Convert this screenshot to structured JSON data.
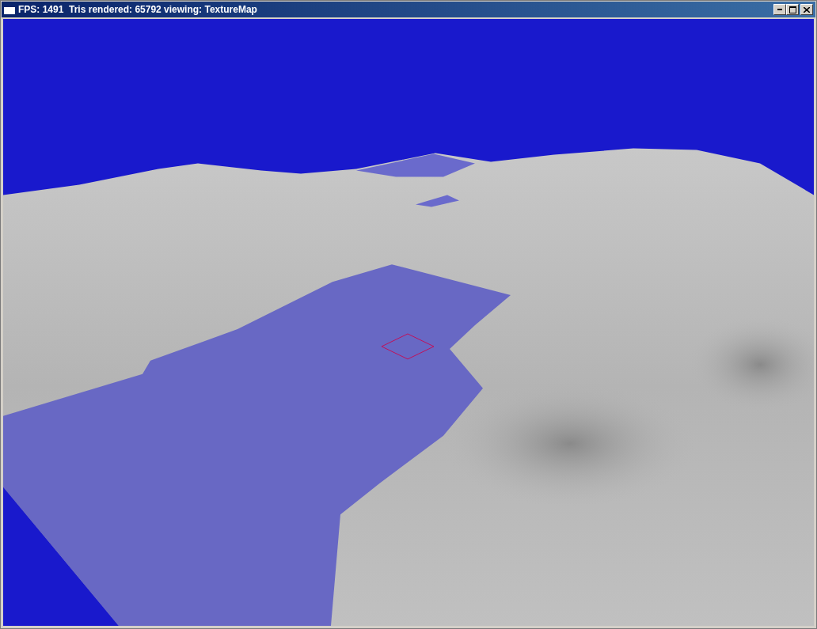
{
  "window": {
    "title": "FPS: 1491  Tris rendered: 65792 viewing: TextureMap"
  }
}
